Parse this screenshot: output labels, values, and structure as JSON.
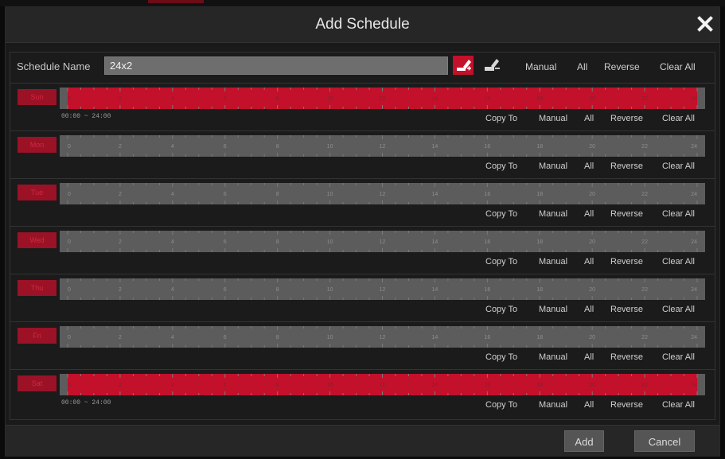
{
  "dialog": {
    "title": "Add Schedule"
  },
  "toolbar": {
    "name_label": "Schedule Name",
    "name_value": "24x2",
    "commands": {
      "manual": "Manual",
      "all": "All",
      "reverse": "Reverse",
      "clear_all": "Clear All"
    }
  },
  "row_actions": {
    "copy_to": "Copy To",
    "manual": "Manual",
    "all": "All",
    "reverse": "Reverse",
    "clear_all": "Clear All"
  },
  "hours": [
    "0",
    "2",
    "4",
    "6",
    "8",
    "10",
    "12",
    "14",
    "16",
    "18",
    "20",
    "22",
    "24"
  ],
  "days": [
    {
      "label": "Sun",
      "scheduled": true,
      "range": "00:00 ~ 24:00"
    },
    {
      "label": "Mon",
      "scheduled": false,
      "range": ""
    },
    {
      "label": "Tue",
      "scheduled": false,
      "range": ""
    },
    {
      "label": "Wed",
      "scheduled": false,
      "range": ""
    },
    {
      "label": "Thu",
      "scheduled": false,
      "range": ""
    },
    {
      "label": "Fri",
      "scheduled": false,
      "range": ""
    },
    {
      "label": "Sat",
      "scheduled": true,
      "range": "00:00 ~ 24:00"
    }
  ],
  "colors": {
    "scheduled": "#c3102b",
    "empty": "#5c5c5c",
    "accent": "#c3102b"
  },
  "footer": {
    "add_label": "Add",
    "cancel_label": "Cancel"
  }
}
